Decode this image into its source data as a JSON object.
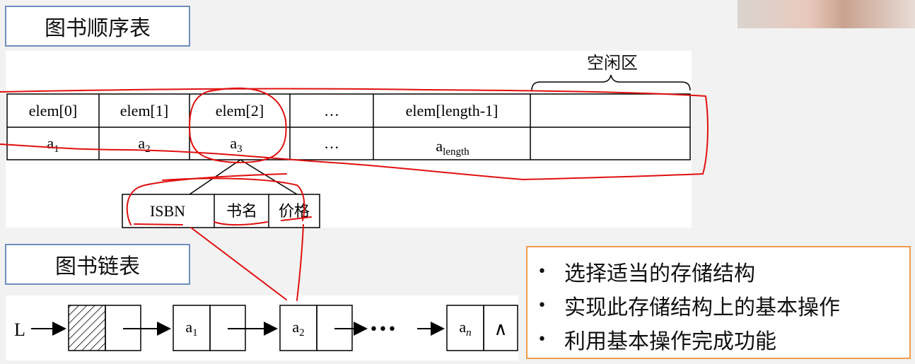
{
  "titles": {
    "sequential": "图书顺序表",
    "linked": "图书链表"
  },
  "free_area_label": "空闲区",
  "array_headers": [
    "elem[0]",
    "elem[1]",
    "elem[2]",
    "…",
    "elem[length-1]"
  ],
  "array_values": [
    {
      "base": "a",
      "sub": "1"
    },
    {
      "base": "a",
      "sub": "2"
    },
    {
      "base": "a",
      "sub": "3"
    },
    {
      "base": "…",
      "sub": ""
    },
    {
      "base": "a",
      "sub": "length"
    }
  ],
  "record_fields": [
    "ISBN",
    "书名",
    "价格"
  ],
  "linked_list": {
    "head_label": "L",
    "nodes": [
      {
        "base": "a",
        "sub": "1"
      },
      {
        "base": "a",
        "sub": "2"
      },
      {
        "base": "a",
        "sub": "n"
      }
    ],
    "ellipsis": "•••",
    "null_symbol": "∧"
  },
  "bullets": [
    "选择适当的存储结构",
    "实现此存储结构上的基本操作",
    "利用基本操作完成功能"
  ],
  "colors": {
    "title_border": "#6e8fbf",
    "bullet_border": "#ef9b4c",
    "annotation": "#e01010"
  }
}
